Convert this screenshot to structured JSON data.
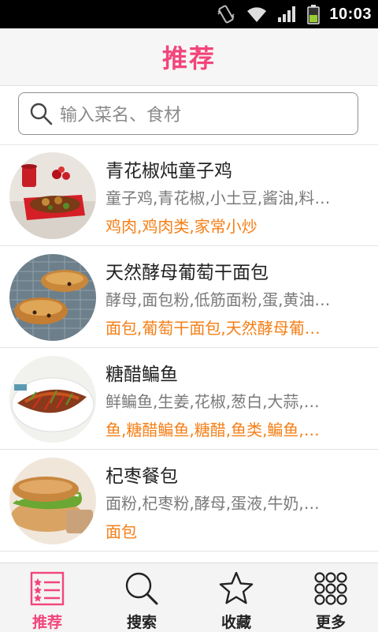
{
  "status_bar": {
    "time": "10:03"
  },
  "header": {
    "title": "推荐"
  },
  "search": {
    "placeholder": "输入菜名、食材"
  },
  "recipes": [
    {
      "title": "青花椒炖童子鸡",
      "ingredients": "童子鸡,青花椒,小土豆,酱油,料…",
      "tags": "鸡肉,鸡肉类,家常小炒"
    },
    {
      "title": "天然酵母葡萄干面包",
      "ingredients": "酵母,面包粉,低筋面粉,蛋,黄油…",
      "tags": "面包,葡萄干面包,天然酵母葡…"
    },
    {
      "title": "糖醋鳊鱼",
      "ingredients": "鲜鳊鱼,生姜,花椒,葱白,大蒜,…",
      "tags": "鱼,糖醋鳊鱼,糖醋,鱼类,鳊鱼,…"
    },
    {
      "title": "杞枣餐包",
      "ingredients": "面粉,杞枣粉,酵母,蛋液,牛奶,…",
      "tags": "面包"
    }
  ],
  "bottom_nav": [
    {
      "label": "推荐",
      "icon": "list-icon",
      "active": true
    },
    {
      "label": "搜索",
      "icon": "search-icon",
      "active": false
    },
    {
      "label": "收藏",
      "icon": "star-icon",
      "active": false
    },
    {
      "label": "更多",
      "icon": "grid-icon",
      "active": false
    }
  ],
  "colors": {
    "accent": "#f2457b",
    "tag": "#f57f17",
    "muted": "#7a7a7a"
  }
}
